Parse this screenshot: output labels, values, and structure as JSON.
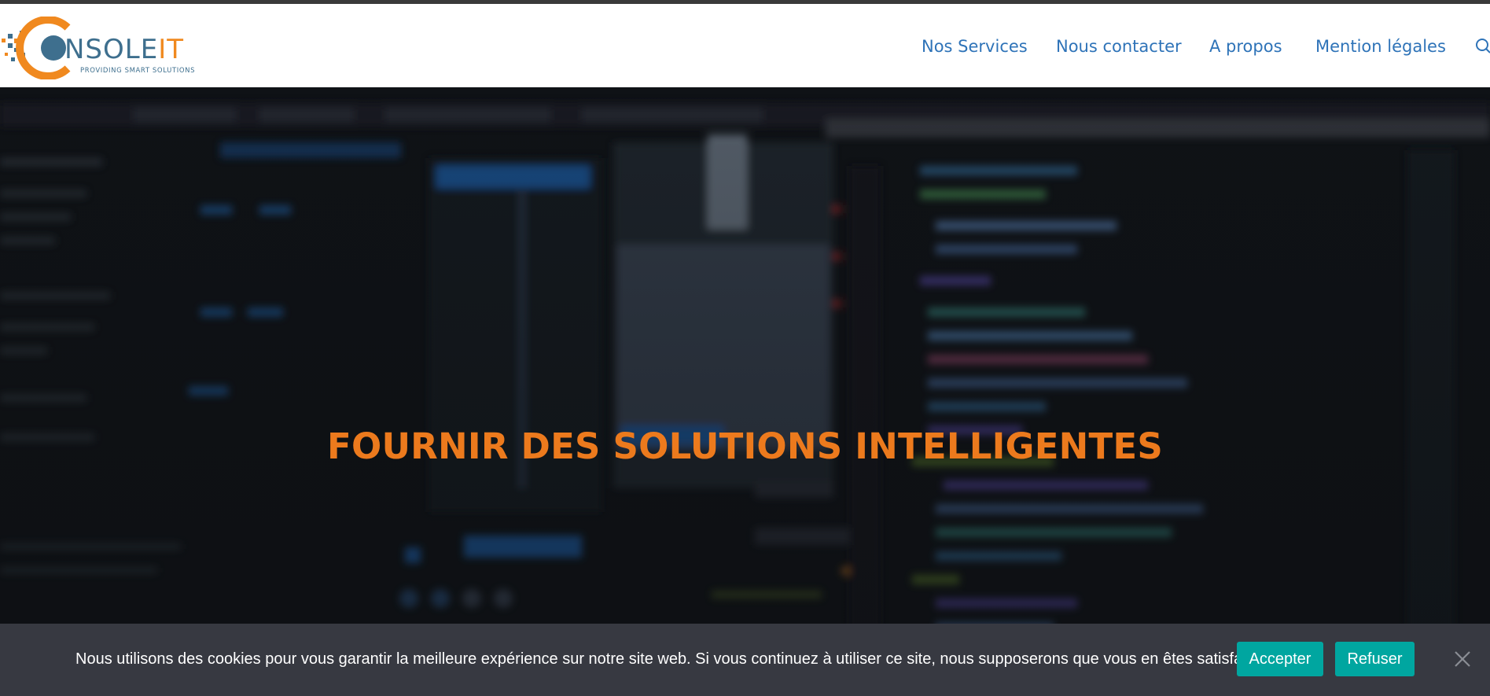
{
  "header": {
    "logo": {
      "word_orange": "C",
      "word_blue": "NSOLE",
      "word_orange_2": "IT",
      "tagline": "PROVIDING SMART SOLUTIONS"
    },
    "nav": [
      {
        "label": "Nos Services"
      },
      {
        "label": "Nous contacter"
      },
      {
        "label": "A propos"
      },
      {
        "label": "Mention légales"
      }
    ],
    "search_icon": "search-icon"
  },
  "hero": {
    "title": "FOURNIR DES SOLUTIONS INTELLIGENTES",
    "background": "blurred-code-editor"
  },
  "cookie_banner": {
    "message": "Nous utilisons des cookies pour vous garantir la meilleure expérience sur notre site web. Si vous continuez à utiliser ce site, nous supposerons que vous en êtes satisfait.",
    "accept_label": "Accepter",
    "refuse_label": "Refuser",
    "close_icon": "close-icon"
  },
  "colors": {
    "brand_orange": "#ec7a1d",
    "brand_blue": "#3e6f8e",
    "nav_link": "#2e73b8",
    "cookie_button": "#00a6a0",
    "cookie_bar": "#373941"
  }
}
